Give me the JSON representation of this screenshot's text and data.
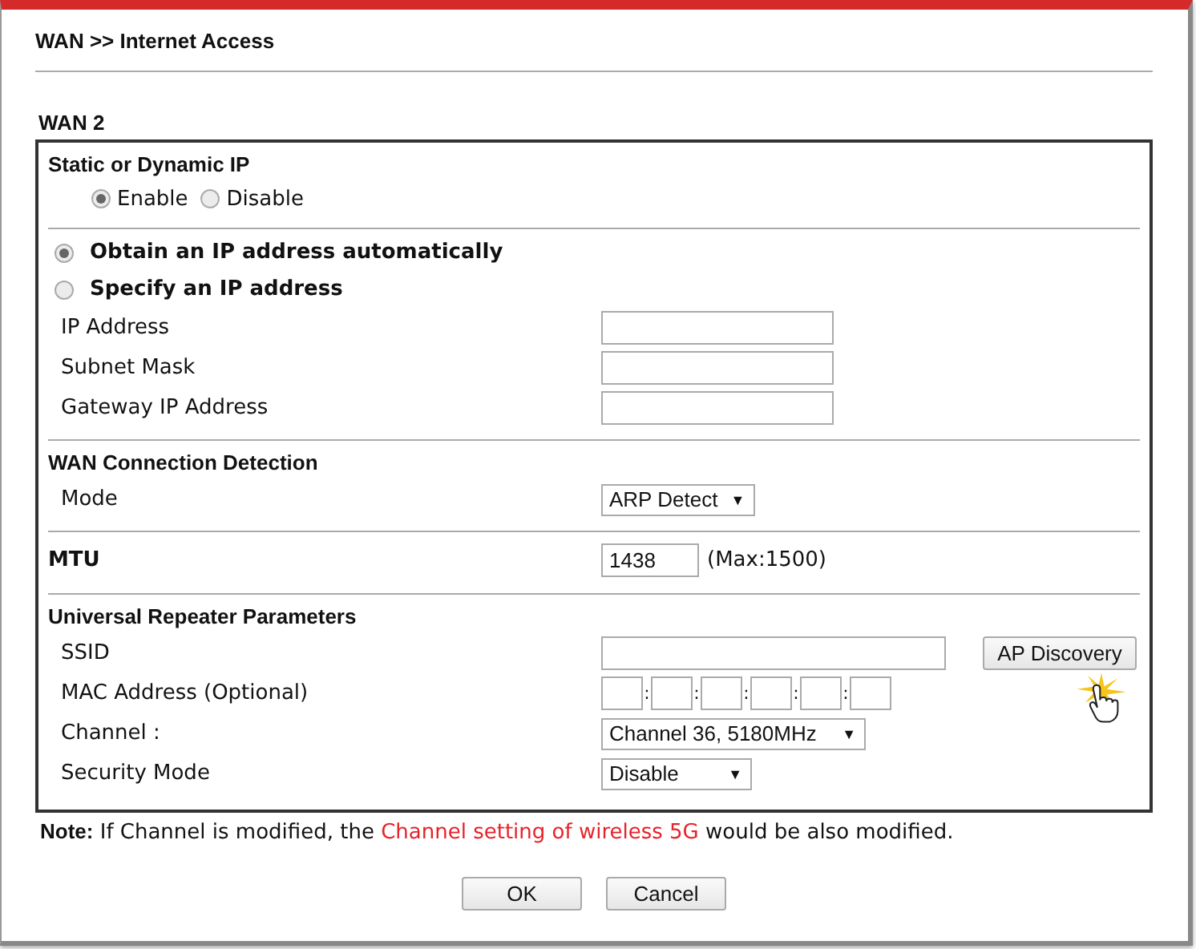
{
  "breadcrumb": "WAN >> Internet Access",
  "section_title": "WAN 2",
  "groups": [
    {
      "title": "Static or Dynamic IP",
      "rows": [
        {
          "kind": "radio_inline",
          "options": [
            {
              "label": "Enable",
              "selected": true
            },
            {
              "label": "Disable",
              "selected": false
            }
          ]
        }
      ]
    },
    {
      "rows": [
        {
          "kind": "radio",
          "label": "Obtain an IP address automatically",
          "selected": true
        },
        {
          "kind": "radio",
          "label": "Specify an IP address",
          "selected": false
        },
        {
          "kind": "text",
          "label": "IP Address"
        },
        {
          "kind": "text",
          "label": "Subnet Mask"
        },
        {
          "kind": "text",
          "label": "Gateway IP Address"
        }
      ]
    },
    {
      "title": "WAN Connection Detection",
      "rows": [
        {
          "kind": "select",
          "label": "Mode",
          "value": "ARP Detect",
          "arrow": "▼"
        }
      ]
    },
    {
      "rows": [
        {
          "kind": "mtu",
          "label": "MTU",
          "value": "1438",
          "hint": "(Max:1500)"
        }
      ]
    },
    {
      "title": "Universal Repeater Parameters",
      "rows": [
        {
          "kind": "ssid",
          "label": "SSID",
          "button": "AP Discovery"
        },
        {
          "kind": "mac",
          "label": "MAC Address (Optional)",
          "separator": ":"
        },
        {
          "kind": "select",
          "label": "Channel :",
          "value": "Channel 36, 5180MHz",
          "arrow": "▼",
          "wide": true
        },
        {
          "kind": "select",
          "label": "Security Mode",
          "value": "Disable",
          "arrow": "▼"
        }
      ]
    }
  ],
  "note": {
    "label": "Note:",
    "parts": [
      {
        "text": "If Channel is modified, the ",
        "highlight": false
      },
      {
        "text": "Channel setting of wireless 5G",
        "highlight": true
      },
      {
        "text": " would be also modified.",
        "highlight": false
      }
    ]
  },
  "buttons": [
    "OK",
    "Cancel"
  ]
}
